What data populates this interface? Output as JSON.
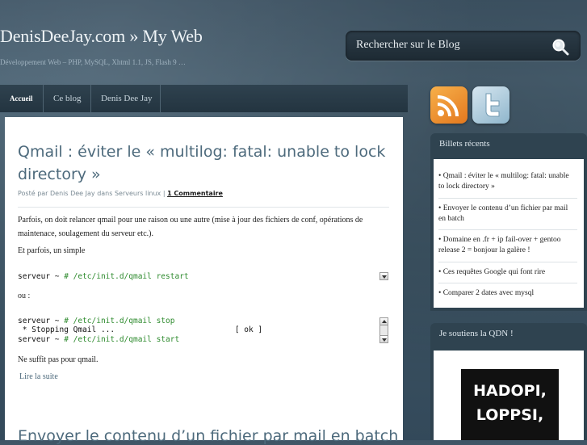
{
  "header": {
    "title": "DenisDeeJay.com » My Web",
    "tagline": "Développement Web – PHP, MySQL, Xhtml 1.1, JS, Flash 9 …",
    "search_placeholder": "Rechercher sur le Blog"
  },
  "nav": {
    "items": [
      "Accueil",
      "Ce blog",
      "Denis Dee Jay"
    ]
  },
  "post": {
    "title": "Qmail : éviter le « multilog: fatal: unable to lock directory »",
    "meta_prefix": "Posté par Denis Dee Jay dans Serveurs linux | ",
    "comments_link": "1 Commentaire",
    "para1": "Parfois, on doit relancer qmail pour une raison ou une autre (mise à jour des fichiers de conf, opérations de maintenace, soulagement du serveur etc.).",
    "para2": "Et parfois, un simple",
    "code1_prompt": "serveur ~ ",
    "code1_cmd": "# /etc/init.d/qmail restart",
    "para3": "ou :",
    "code2_line1_prompt": "serveur ~ ",
    "code2_line1_cmd": "# /etc/init.d/qmail stop",
    "code2_line2": " * Stopping Qmail ...                          [ ok ]",
    "code2_line3_prompt": "serveur ~ ",
    "code2_line3_cmd": "# /etc/init.d/qmail start",
    "para4": "Ne suffit pas pour qmail.",
    "read_more": "Lire la suite"
  },
  "next_post_title": "Envoyer le contenu d’un fichier par mail en batch",
  "sidebar": {
    "recent_title": "Billets récents",
    "recent": [
      "Qmail : éviter le « multilog: fatal: unable to lock directory »",
      "Envoyer le contenu d’un fichier par mail en batch",
      "Domaine en .fr + ip fail-over + gentoo release 2 = bonjour la galère !",
      "Ces requêtes Google qui font rire",
      "Comparer 2 dates avec mysql"
    ],
    "support_title": "Je soutiens la QDN !",
    "banner_line1": "HADOPI,",
    "banner_line2": "LOPPSI,"
  },
  "icons": {
    "rss": "rss-feed-icon",
    "twitter": "twitter-bird-icon",
    "search": "search-magnifier-icon"
  }
}
